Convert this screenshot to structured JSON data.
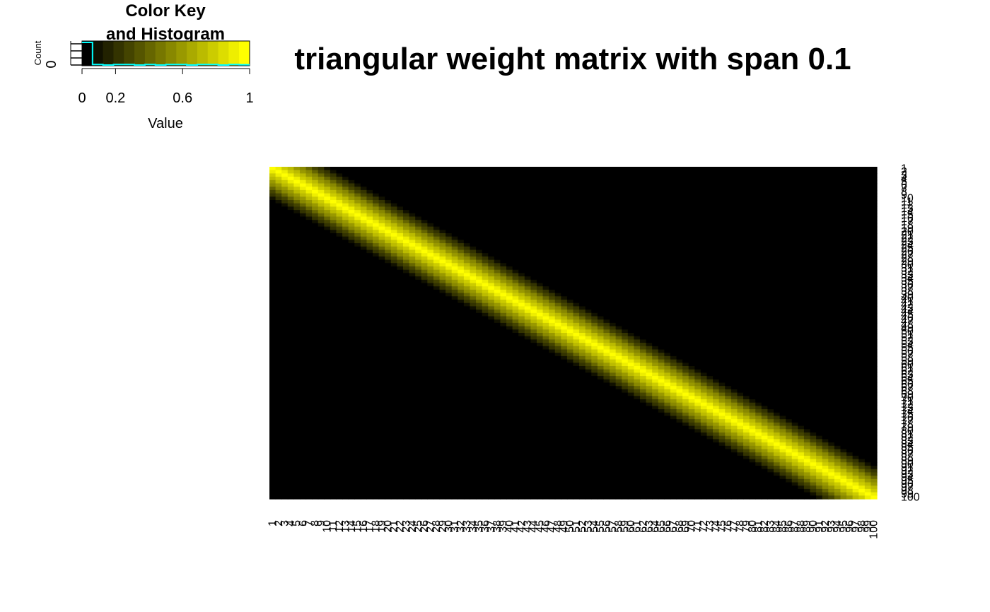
{
  "chart_data": {
    "type": "heatmap",
    "title": "triangular weight matrix with span 0.1",
    "rows": 100,
    "cols": 100,
    "span": 0.1,
    "labels": {
      "rows": [
        "1",
        "2",
        "3",
        "4",
        "5",
        "6",
        "7",
        "8",
        "9",
        "10",
        "11",
        "12",
        "13",
        "14",
        "15",
        "16",
        "17",
        "18",
        "19",
        "20",
        "21",
        "22",
        "23",
        "24",
        "25",
        "26",
        "27",
        "28",
        "29",
        "30",
        "31",
        "32",
        "33",
        "34",
        "35",
        "36",
        "37",
        "38",
        "39",
        "40",
        "41",
        "42",
        "43",
        "44",
        "45",
        "46",
        "47",
        "48",
        "49",
        "50",
        "51",
        "52",
        "53",
        "54",
        "55",
        "56",
        "57",
        "58",
        "59",
        "60",
        "61",
        "62",
        "63",
        "64",
        "65",
        "66",
        "67",
        "68",
        "69",
        "70",
        "71",
        "72",
        "73",
        "74",
        "75",
        "76",
        "77",
        "78",
        "79",
        "80",
        "81",
        "82",
        "83",
        "84",
        "85",
        "86",
        "87",
        "88",
        "89",
        "90",
        "91",
        "92",
        "93",
        "94",
        "95",
        "96",
        "97",
        "98",
        "99",
        "100"
      ],
      "cols": [
        "1",
        "2",
        "3",
        "4",
        "5",
        "6",
        "7",
        "8",
        "9",
        "10",
        "11",
        "12",
        "13",
        "14",
        "15",
        "16",
        "17",
        "18",
        "19",
        "20",
        "21",
        "22",
        "23",
        "24",
        "25",
        "26",
        "27",
        "28",
        "29",
        "30",
        "31",
        "32",
        "33",
        "34",
        "35",
        "36",
        "37",
        "38",
        "39",
        "40",
        "41",
        "42",
        "43",
        "44",
        "45",
        "46",
        "47",
        "48",
        "49",
        "50",
        "51",
        "52",
        "53",
        "54",
        "55",
        "56",
        "57",
        "58",
        "59",
        "60",
        "61",
        "62",
        "63",
        "64",
        "65",
        "66",
        "67",
        "68",
        "69",
        "70",
        "71",
        "72",
        "73",
        "74",
        "75",
        "76",
        "77",
        "78",
        "79",
        "80",
        "81",
        "82",
        "83",
        "84",
        "85",
        "86",
        "87",
        "88",
        "89",
        "90",
        "91",
        "92",
        "93",
        "94",
        "95",
        "96",
        "97",
        "98",
        "99",
        "100"
      ]
    },
    "value_range": [
      0,
      1
    ],
    "colors": {
      "low": "#000000",
      "high": "#ffff00",
      "histogram": "#00ffff"
    },
    "color_key": {
      "title_lines": [
        "Color Key",
        "and Histogram"
      ],
      "ticks": [
        "0",
        "0.2",
        "0.6",
        "1"
      ],
      "tick_values": [
        0,
        0.2,
        0.6,
        1
      ],
      "bins": 16,
      "xlabel": "Value",
      "ylabel": "Count",
      "y_tick": "0"
    }
  }
}
